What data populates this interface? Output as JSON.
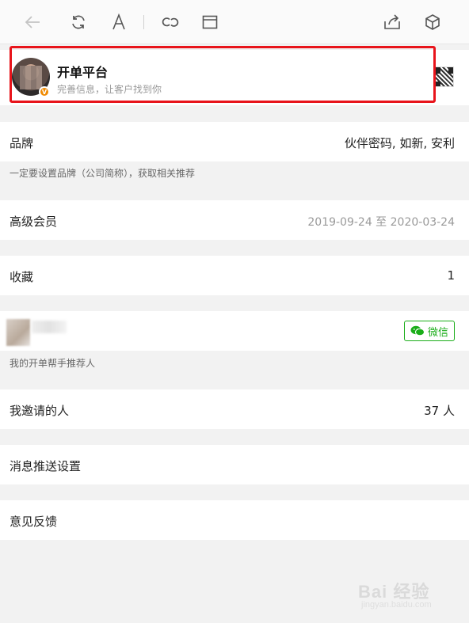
{
  "toolbar": {
    "icons": [
      "back-arrow-icon",
      "refresh-icon",
      "font-icon",
      "link-icon",
      "window-icon",
      "share-icon",
      "cube-icon"
    ]
  },
  "profile": {
    "name": "开单平台",
    "subtitle": "完善信息，让客户找到你",
    "badge": "V"
  },
  "brand": {
    "label": "品牌",
    "value": "伙伴密码, 如新, 安利",
    "hint": "一定要设置品牌（公司简称），获取相关推荐"
  },
  "membership": {
    "label": "高级会员",
    "value": "2019-09-24 至 2020-03-24"
  },
  "favorites": {
    "label": "收藏",
    "value": "1"
  },
  "referrer": {
    "wechat_label": "微信",
    "hint": "我的开单帮手推荐人"
  },
  "invited": {
    "label": "我邀请的人",
    "value": "37 人"
  },
  "push_settings": {
    "label": "消息推送设置"
  },
  "feedback": {
    "label": "意见反馈"
  },
  "watermark": {
    "text": "Bai 经验",
    "url": "jingyan.baidu.com"
  },
  "colors": {
    "highlight": "#e8141b",
    "wechat_green": "#1aad19",
    "vip_badge": "#f08a00"
  }
}
